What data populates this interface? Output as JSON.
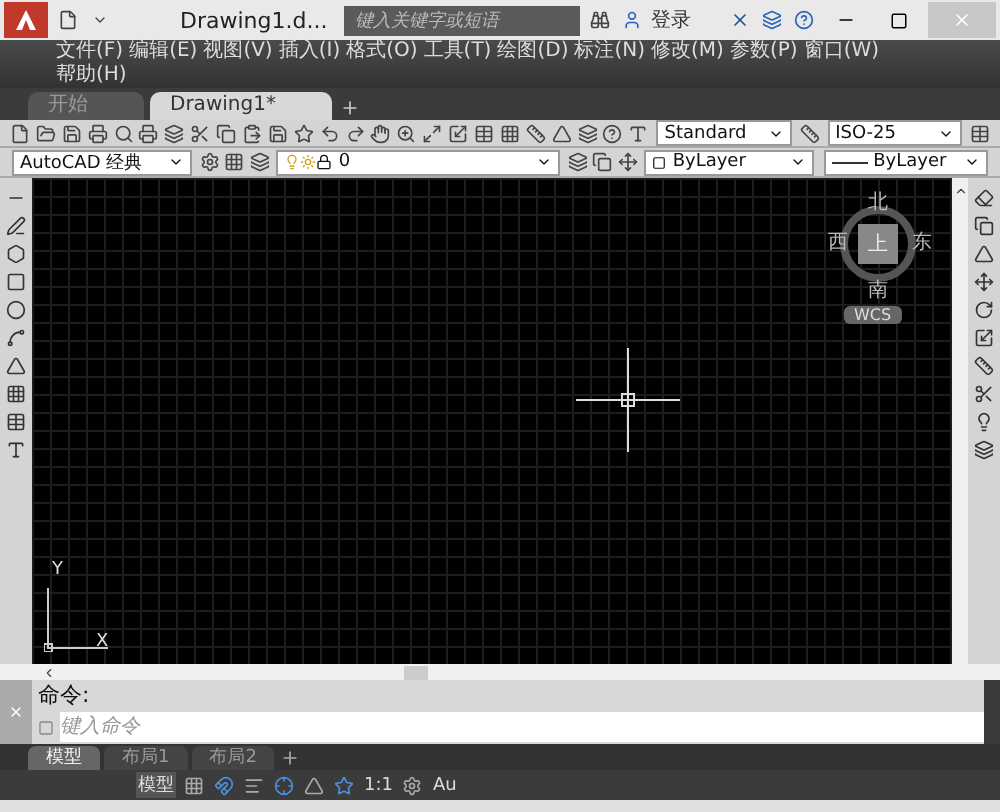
{
  "title_bar": {
    "title": "Drawing1.d...",
    "search": {
      "placeholder": "键入关键字或短语"
    },
    "sign_in": "登录"
  },
  "menu": [
    "文件(F)",
    "编辑(E)",
    "视图(V)",
    "插入(I)",
    "格式(O)",
    "工具(T)",
    "绘图(D)",
    "标注(N)",
    "修改(M)",
    "参数(P)",
    "窗口(W)",
    "帮助(H)"
  ],
  "file_tabs": [
    {
      "label": "开始",
      "selected": false
    },
    {
      "label": "Drawing1*",
      "selected": true
    }
  ],
  "styles": {
    "text_style": "Standard",
    "dim_style": "ISO-25"
  },
  "properties": {
    "workspace": "AutoCAD 经典",
    "layer": "0",
    "color_setting": "ByLayer",
    "linetype": "ByLayer"
  },
  "viewcube": {
    "north": "北",
    "west": "西",
    "east": "东",
    "south": "南",
    "top": "上",
    "wcs": "WCS"
  },
  "ucs": {
    "x": "X",
    "y": "Y"
  },
  "command": {
    "history": "命令:",
    "placeholder": "键入命令"
  },
  "layout_tabs": [
    {
      "label": "模型",
      "selected": true
    },
    {
      "label": "布局1",
      "selected": false
    },
    {
      "label": "布局2",
      "selected": false
    }
  ],
  "status_bar": {
    "mode": "模型",
    "scale": "1:1",
    "annotation": "Au"
  }
}
